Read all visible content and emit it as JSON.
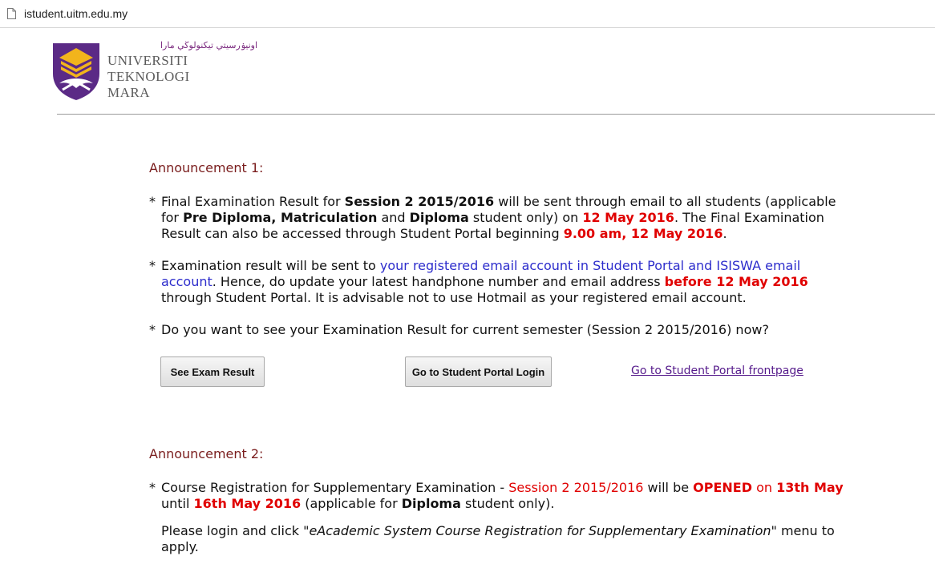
{
  "browser": {
    "url": "istudent.uitm.edu.my",
    "page_icon": "page-icon"
  },
  "logo": {
    "jawi": "اونيۏرسيتي تيكنولوڬي مارا",
    "line1": "UNIVERSITI",
    "line2": "TEKNOLOGI",
    "line3": "MARA",
    "colors": {
      "purple": "#5b2a86",
      "gold": "#f2b41c"
    }
  },
  "announcement1": {
    "title": "Announcement 1:",
    "item1": {
      "t1": "Final Examination Result for ",
      "b1": "Session 2 2015/2016",
      "t2": " will be sent through email to all students (applicable for ",
      "b2": "Pre Diploma, Matriculation",
      "t3": " and ",
      "b3": "Diploma",
      "t4": " student only) on ",
      "r1": "12 May 2016",
      "t5": ". The Final Examination Result can also be accessed through Student Portal beginning ",
      "r2": "9.00 am, 12 May 2016",
      "t6": "."
    },
    "item2": {
      "t1": "Examination result will be sent to ",
      "blue": "your registered email account in Student Portal and ISISWA email account",
      "t2": ". Hence, do update your latest handphone number and email address ",
      "r1": "before 12 May 2016",
      "t3": " through Student Portal. It is advisable not to use Hotmail as your registered email account."
    },
    "item3": "Do you want to see your Examination Result for current semester (Session 2 2015/2016) now?",
    "buttons": {
      "see_result": "See Exam Result",
      "portal_login": "Go to Student Portal Login",
      "frontpage_link": "Go to Student Portal frontpage"
    }
  },
  "announcement2": {
    "title": "Announcement 2:",
    "item1": {
      "t1": "Course Registration for Supplementary Examination - ",
      "r1": "Session 2 2015/2016",
      "t2": " will be ",
      "r2": "OPENED",
      "r3": " on ",
      "r4": "13th May",
      "t3": " until ",
      "r5": "16th May 2016",
      "t4": " (applicable for ",
      "b1": "Diploma",
      "t5": " student only)."
    },
    "para": {
      "t1": "Please login and click \"",
      "i1": "eAcademic System Course Registration for Supplementary Examination",
      "t2": "\" menu to apply."
    }
  },
  "star": "*"
}
